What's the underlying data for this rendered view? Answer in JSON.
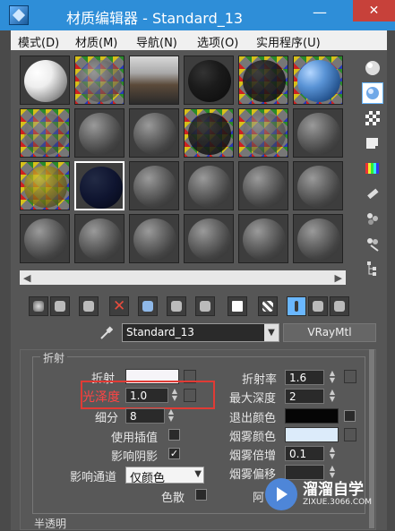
{
  "window": {
    "title": "材质编辑器 - Standard_13",
    "minimize": "—",
    "close": "✕"
  },
  "menu": [
    "模式(D)",
    "材质(M)",
    "导航(N)",
    "选项(O)",
    "实用程序(U)"
  ],
  "colors": {
    "titlebar": "#2e8ed8",
    "close": "#c7413a",
    "highlight_box": "#e03b35",
    "highlight_label": "#ff4444",
    "active_tool": "#6ab7ff"
  },
  "icons": {
    "side_tools": [
      "sample-type-sphere-icon",
      "backlight-icon",
      "background-checker-icon",
      "sample-uv-tiling-icon",
      "video-color-check-icon",
      "make-preview-icon",
      "options-icon",
      "select-by-material-icon",
      "material-map-navigator-icon"
    ],
    "toolbar": [
      "get-material-icon",
      "put-material-to-scene-icon",
      "assign-material-icon",
      "reset-map-icon",
      "make-copy-icon",
      "make-unique-icon",
      "put-to-library-icon",
      "material-id-channel-icon",
      "show-map-in-viewport-icon",
      "show-end-result-icon",
      "go-to-parent-icon",
      "go-forward-to-sibling-icon"
    ]
  },
  "material": {
    "name": "Standard_13",
    "type_button": "VRayMtl",
    "eyedropper": "eyedropper-icon"
  },
  "refraction_rollout": {
    "title": "折射",
    "refract_label": "折射",
    "glossiness_label": "光泽度",
    "glossiness_value": "1.0",
    "subdivs_label": "细分",
    "subdivs_value": "8",
    "use_interpolation_label": "使用插值",
    "affect_shadows_label": "影响阴影",
    "affect_shadows_checked": "✓",
    "affect_channels_label": "影响通道",
    "affect_channels_value": "仅颜色",
    "dispersion_label": "色散",
    "ior_label": "折射率",
    "ior_value": "1.6",
    "max_depth_label": "最大深度",
    "max_depth_value": "2",
    "exit_color_label": "退出颜色",
    "fog_color_label": "烟雾颜色",
    "fog_multiplier_label": "烟雾倍增",
    "fog_multiplier_value": "0.1",
    "fog_bias_label": "烟雾偏移",
    "abbe_label": "阿"
  },
  "translucency_rollout": {
    "title": "半透明"
  },
  "watermark": {
    "title": "溜溜自学",
    "subtitle": "ZIXUE.3066.COM"
  }
}
